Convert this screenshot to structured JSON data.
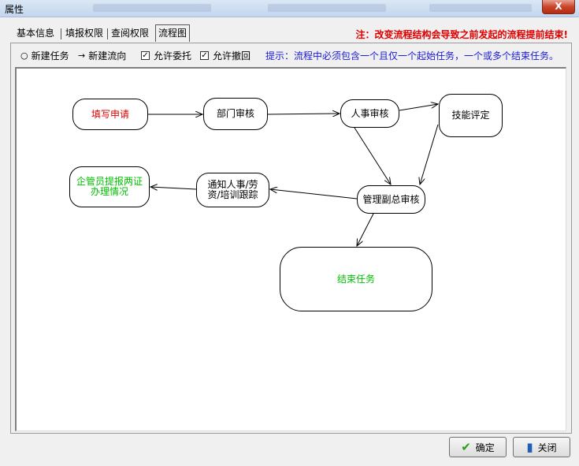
{
  "window": {
    "title": "属性",
    "close_label": "X"
  },
  "tabs": [
    {
      "label": "基本信息",
      "active": false
    },
    {
      "label": "填报权限",
      "active": false
    },
    {
      "label": "查阅权限",
      "active": false
    },
    {
      "label": "流程图",
      "active": true
    }
  ],
  "warning": "注：改变流程结构会导致之前发起的流程提前结束!",
  "toolbar": {
    "new_task": "新建任务",
    "new_flow": "新建流向",
    "allow_delegate": "允许委托",
    "allow_delegate_checked": true,
    "allow_withdraw": "允许撤回",
    "allow_withdraw_checked": true,
    "hint": "提示：流程中必须包含一个且仅一个起始任务，一个或多个结束任务。"
  },
  "flow": {
    "nodes": {
      "fill": {
        "label": "填写申请",
        "color": "#e00000"
      },
      "dept": {
        "label": "部门审核",
        "color": "#000000"
      },
      "hr": {
        "label": "人事审核",
        "color": "#000000"
      },
      "skill": {
        "label": "技能评定",
        "color": "#000000"
      },
      "vp": {
        "label": "管理副总审核",
        "color": "#000000"
      },
      "notify": {
        "line1": "通知人事/劳",
        "line2": "资/培训跟踪",
        "color": "#000000"
      },
      "cert": {
        "line1": "企管员提报两证",
        "line2": "办理情况",
        "color": "#00c000"
      },
      "end": {
        "label": "结束任务",
        "color": "#00c000"
      }
    }
  },
  "buttons": {
    "ok": "确定",
    "close": "关闭"
  }
}
